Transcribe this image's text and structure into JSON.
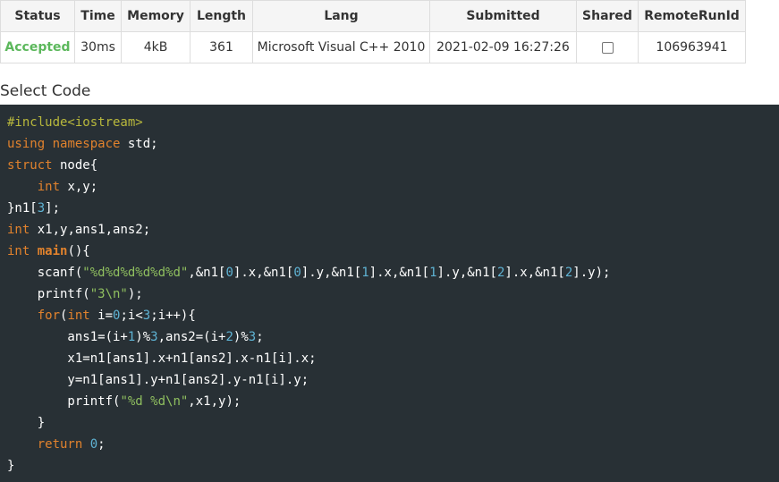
{
  "table": {
    "headers": [
      "Status",
      "Time",
      "Memory",
      "Length",
      "Lang",
      "Submitted",
      "Shared",
      "RemoteRunId"
    ],
    "row": {
      "status": "Accepted",
      "time": "30ms",
      "memory": "4kB",
      "length": "361",
      "lang": "Microsoft Visual C++ 2010",
      "submitted": "2021-02-09 16:27:26",
      "shared_checked": false,
      "remote_run_id": "106963941"
    }
  },
  "select_code_label": "Select Code",
  "code": {
    "lines": [
      [
        [
          "p",
          "#include<iostream>"
        ]
      ],
      [
        [
          "k",
          "using"
        ],
        [
          "t",
          " "
        ],
        [
          "k",
          "namespace"
        ],
        [
          "t",
          " std;"
        ]
      ],
      [
        [
          "k",
          "struct"
        ],
        [
          "t",
          " node{"
        ]
      ],
      [
        [
          "t",
          "    "
        ],
        [
          "k",
          "int"
        ],
        [
          "t",
          " x,y;"
        ]
      ],
      [
        [
          "t",
          "}n1["
        ],
        [
          "n",
          "3"
        ],
        [
          "t",
          "];"
        ]
      ],
      [
        [
          "k",
          "int"
        ],
        [
          "t",
          " x1,y,ans1,ans2;"
        ]
      ],
      [
        [
          "k",
          "int"
        ],
        [
          "t",
          " "
        ],
        [
          "kb",
          "main"
        ],
        [
          "t",
          "(){"
        ]
      ],
      [
        [
          "t",
          "    scanf("
        ],
        [
          "s",
          "\"%d%d%d%d%d%d\""
        ],
        [
          "t",
          ",&n1["
        ],
        [
          "n",
          "0"
        ],
        [
          "t",
          "].x,&n1["
        ],
        [
          "n",
          "0"
        ],
        [
          "t",
          "].y,&n1["
        ],
        [
          "n",
          "1"
        ],
        [
          "t",
          "].x,&n1["
        ],
        [
          "n",
          "1"
        ],
        [
          "t",
          "].y,&n1["
        ],
        [
          "n",
          "2"
        ],
        [
          "t",
          "].x,&n1["
        ],
        [
          "n",
          "2"
        ],
        [
          "t",
          "].y);"
        ]
      ],
      [
        [
          "t",
          "    printf("
        ],
        [
          "s",
          "\"3\\n\""
        ],
        [
          "t",
          ");"
        ]
      ],
      [
        [
          "t",
          "    "
        ],
        [
          "k",
          "for"
        ],
        [
          "t",
          "("
        ],
        [
          "k",
          "int"
        ],
        [
          "t",
          " i="
        ],
        [
          "n",
          "0"
        ],
        [
          "t",
          ";i<"
        ],
        [
          "n",
          "3"
        ],
        [
          "t",
          ";i++){"
        ]
      ],
      [
        [
          "t",
          "        ans1=(i+"
        ],
        [
          "n",
          "1"
        ],
        [
          "t",
          ")%"
        ],
        [
          "n",
          "3"
        ],
        [
          "t",
          ",ans2=(i+"
        ],
        [
          "n",
          "2"
        ],
        [
          "t",
          ")%"
        ],
        [
          "n",
          "3"
        ],
        [
          "t",
          ";"
        ]
      ],
      [
        [
          "t",
          "        x1=n1[ans1].x+n1[ans2].x-n1[i].x;"
        ]
      ],
      [
        [
          "t",
          "        y=n1[ans1].y+n1[ans2].y-n1[i].y;"
        ]
      ],
      [
        [
          "t",
          "        printf("
        ],
        [
          "s",
          "\"%d %d\\n\""
        ],
        [
          "t",
          ",x1,y);"
        ]
      ],
      [
        [
          "t",
          "    }"
        ]
      ],
      [
        [
          "t",
          "    "
        ],
        [
          "k",
          "return"
        ],
        [
          "t",
          " "
        ],
        [
          "n",
          "0"
        ],
        [
          "t",
          ";"
        ]
      ],
      [
        [
          "t",
          "}"
        ]
      ]
    ]
  }
}
